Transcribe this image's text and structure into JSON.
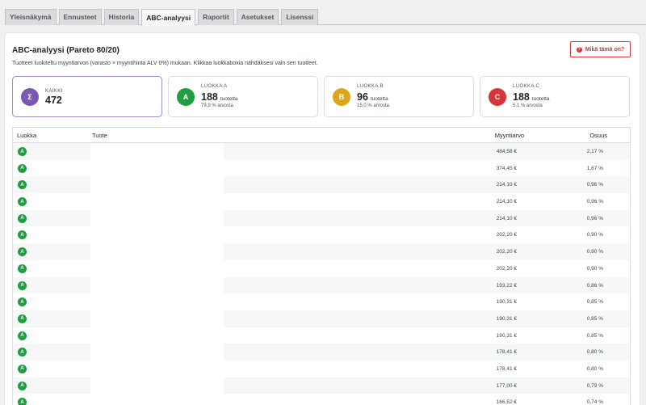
{
  "tabs": [
    {
      "label": "Yleisnäkymä"
    },
    {
      "label": "Ennusteet"
    },
    {
      "label": "Historia"
    },
    {
      "label": "ABC-analyysi"
    },
    {
      "label": "Raportit"
    },
    {
      "label": "Asetukset"
    },
    {
      "label": "Lisenssi"
    }
  ],
  "active_tab": "ABC-analyysi",
  "panel": {
    "title": "ABC-analyysi (Pareto 80/20)",
    "description": "Tuotteet luokiteltu myyntiarvon (varasto × myyntihinta ALV 0%) mukaan. Klikkaa luokkaboxia nähdäksesi vain sen tuotteet.",
    "help_button": "Mikä tämä on?",
    "help_icon": "?"
  },
  "cards": [
    {
      "letter": "Σ",
      "label": "KAIKKI",
      "count": "472",
      "unit": "",
      "share": "",
      "color": "#7c58b4"
    },
    {
      "letter": "A",
      "label": "LUOKKA A",
      "count": "188",
      "unit": "tuotetta",
      "share": "79,9 % arvosta",
      "color": "#1e9e3e"
    },
    {
      "letter": "B",
      "label": "LUOKKA B",
      "count": "96",
      "unit": "tuotetta",
      "share": "15,0 % arvosta",
      "color": "#dba617"
    },
    {
      "letter": "C",
      "label": "LUOKKA C",
      "count": "188",
      "unit": "tuotetta",
      "share": "5,1 % arvosta",
      "color": "#d63638"
    }
  ],
  "table": {
    "headers": {
      "class": "Luokka",
      "product": "Tuote",
      "value": "Myyntiarvo",
      "share": "Osuus"
    },
    "rows": [
      {
        "class": "A",
        "value": "484,58 €",
        "share": "2,17 %"
      },
      {
        "class": "A",
        "value": "374,45 €",
        "share": "1,67 %"
      },
      {
        "class": "A",
        "value": "214,10 €",
        "share": "0,96 %"
      },
      {
        "class": "A",
        "value": "214,10 €",
        "share": "0,96 %"
      },
      {
        "class": "A",
        "value": "214,10 €",
        "share": "0,96 %"
      },
      {
        "class": "A",
        "value": "202,20 €",
        "share": "0,90 %"
      },
      {
        "class": "A",
        "value": "202,20 €",
        "share": "0,90 %"
      },
      {
        "class": "A",
        "value": "202,20 €",
        "share": "0,90 %"
      },
      {
        "class": "A",
        "value": "193,22 €",
        "share": "0,86 %"
      },
      {
        "class": "A",
        "value": "190,31 €",
        "share": "0,85 %"
      },
      {
        "class": "A",
        "value": "190,31 €",
        "share": "0,85 %"
      },
      {
        "class": "A",
        "value": "190,31 €",
        "share": "0,85 %"
      },
      {
        "class": "A",
        "value": "178,41 €",
        "share": "0,80 %"
      },
      {
        "class": "A",
        "value": "178,41 €",
        "share": "0,80 %"
      },
      {
        "class": "A",
        "value": "177,00 €",
        "share": "0,79 %"
      },
      {
        "class": "A",
        "value": "166,52 €",
        "share": "0,74 %"
      }
    ]
  }
}
